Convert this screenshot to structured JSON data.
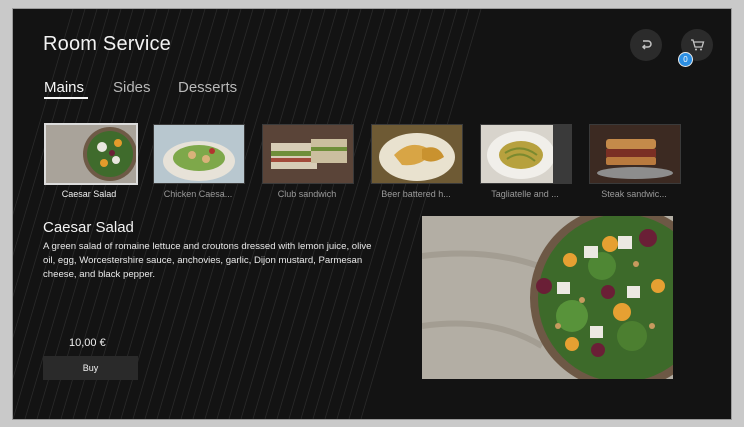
{
  "app": {
    "title": "Room Service"
  },
  "header": {
    "back_icon": "return-arrow-icon",
    "cart_icon": "cart-icon",
    "cart_count": "0"
  },
  "tabs": [
    {
      "label": "Mains",
      "active": true
    },
    {
      "label": "Sides",
      "active": false
    },
    {
      "label": "Desserts",
      "active": false
    }
  ],
  "menu_items": [
    {
      "label": "Caesar Salad",
      "selected": true
    },
    {
      "label": "Chicken Caesa...",
      "selected": false
    },
    {
      "label": "Club sandwich",
      "selected": false
    },
    {
      "label": "Beer battered h...",
      "selected": false
    },
    {
      "label": "Tagliatelle and ...",
      "selected": false
    },
    {
      "label": "Steak sandwic...",
      "selected": false
    }
  ],
  "detail": {
    "name": "Caesar Salad",
    "description": "A green salad of romaine lettuce and croutons dressed with lemon juice, olive oil, egg, Worcestershire sauce, anchovies, garlic, Dijon mustard, Parmesan cheese, and black pepper.",
    "price": "10,00 €",
    "buy_label": "Buy"
  },
  "colors": {
    "background": "#131313",
    "accent_badge": "#2c8fe3",
    "button": "#2a2a2a"
  }
}
